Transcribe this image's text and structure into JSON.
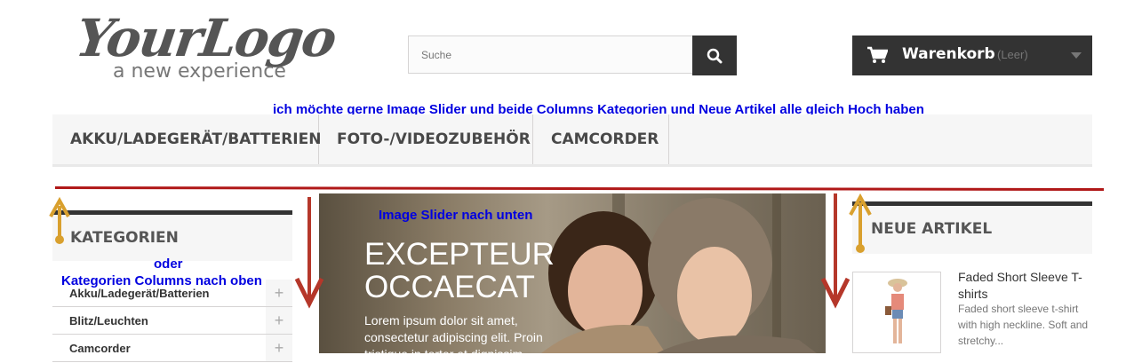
{
  "logo": {
    "main": "YourLogo",
    "sub": "a new experience"
  },
  "search": {
    "placeholder": "Suche"
  },
  "cart": {
    "label": "Warenkorb",
    "status": "(Leer)"
  },
  "annotations": {
    "top": "ich möchte gerne Image Slider und beide Columns Kategorien und Neue Artikel alle gleich Hoch haben",
    "slider": "Image Slider nach unten",
    "or": "oder",
    "columns": "Kategorien Columns nach oben"
  },
  "menu": {
    "items": [
      {
        "label": "AKKU/LADEGERÄT/BATTERIEN"
      },
      {
        "label": "FOTO-/VIDEOZUBEHÖR"
      },
      {
        "label": "CAMCORDER"
      }
    ]
  },
  "categories": {
    "title": "KATEGORIEN",
    "items": [
      {
        "label": "Akku/Ladegerät/Batterien"
      },
      {
        "label": "Blitz/Leuchten"
      },
      {
        "label": "Camcorder"
      }
    ],
    "expand_symbol": "+"
  },
  "slider": {
    "title_line1": "EXCEPTEUR",
    "title_line2": "OCCAECAT",
    "text": "Lorem ipsum dolor sit amet, consectetur adipiscing elit. Proin tristique in tortor et dignissim."
  },
  "new_products": {
    "title": "NEUE ARTIKEL",
    "product": {
      "name": "Faded Short Sleeve T-shirts",
      "description": "Faded short sleeve t-shirt with high neckline. Soft and stretchy..."
    }
  },
  "colors": {
    "accent_dark": "#333333",
    "annotation_blue": "#0000e0",
    "arrow_red": "#b5372a",
    "arrow_gold": "#d9a02e"
  }
}
